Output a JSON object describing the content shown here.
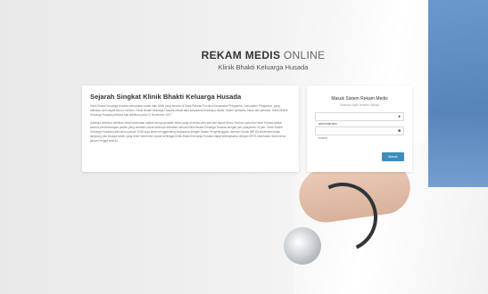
{
  "header": {
    "title_bold": "REKAM MEDIS",
    "title_light": "ONLINE",
    "subtitle": "Klinik Bhakti Keluarga Husada"
  },
  "history": {
    "title": "Sejarah Singkat Klinik Bhakti Keluarga Husada",
    "paragraph1": "Klinik Bhakti Keluarga Husada merupakan salah satu klinik yang berada di Desa Pabean Provinsi Kecamatan Pringamus, Kabupaten Pringamus, yang didirikan oleh bapak Bruno Kertono. Klinik Bhakti Keluarga Husada dibuat atas kerjasama beberapa dokter, dokter spesialis, bidan dan perawat. Klinik Bhakti Keluarga Husada pertama kali didirikan pada 01 November 2017.",
    "paragraph2": "Awalnya sebelum didirikan klinik kesehatan adalah berupa praktek bidan yang di kelola oleh istri dari bapak Bruno Kertono yaitu ibu Henri Kubisa,sekitar karena perkembangan pasien yang semakin pesat akhirnya dibuatlah sebuah klinik Bhakti Keluarga Husada dengan jam pelayanan 24 jam. Klinik Bhakti Keluarga Husada pada tahun januari 2018 juga telah menggandeng kerjasama dengan Badan Penyelenggara Jaminan Sosial (BPJS) kesehatan bidan langsung dan tenaga dokter yang telah memenuhi syarat sehingga Klinik Bhakti Keluarga Husada dapat bekerjasama dengan BPJS kesehatan mulai tahun januari hingga saat ini."
  },
  "login": {
    "title": "Masuk Sistem Rekam Medis",
    "subtitle": "Silahkan login terlebih dahulu",
    "username_value": "administrator",
    "password_value": "••••••••",
    "submit_label": "Masuk"
  },
  "icons": {
    "user": "user-icon",
    "lock": "lock-icon"
  }
}
